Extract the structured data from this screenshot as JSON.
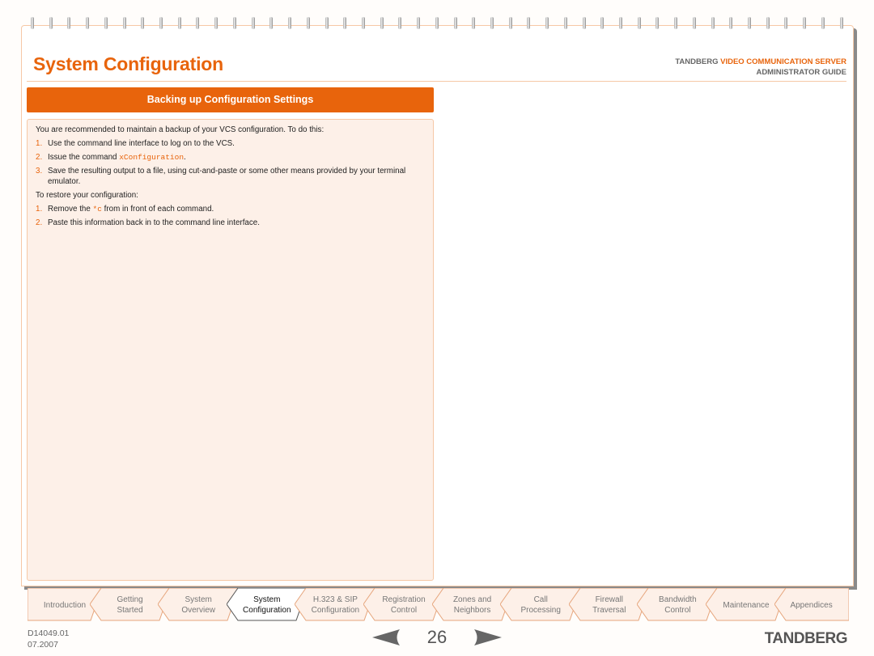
{
  "header": {
    "title": "System Configuration",
    "brand_prefix": "TANDBERG",
    "brand_product": "VIDEO COMMUNICATION SERVER",
    "guide": "ADMINISTRATOR GUIDE"
  },
  "section": {
    "title": "Backing up Configuration Settings",
    "intro": "You are recommended to maintain a backup of your VCS configuration. To do this:",
    "backup_steps": [
      {
        "num": "1.",
        "text": "Use the command line interface to log on to the VCS."
      },
      {
        "num": "2.",
        "text_before": "Issue the command ",
        "code": "xConfiguration",
        "text_after": "."
      },
      {
        "num": "3.",
        "text": "Save the resulting output to a file, using cut-and-paste or some other means provided by your terminal emulator."
      }
    ],
    "restore_intro": "To restore your configuration:",
    "restore_steps": [
      {
        "num": "1.",
        "text_before": "Remove the ",
        "code": "*c",
        "text_after": " from in front of each command."
      },
      {
        "num": "2.",
        "text": "Paste this information back in to the command line interface."
      }
    ]
  },
  "tabs": [
    {
      "line1": "Introduction",
      "line2": "",
      "active": false
    },
    {
      "line1": "Getting",
      "line2": "Started",
      "active": false
    },
    {
      "line1": "System",
      "line2": "Overview",
      "active": false
    },
    {
      "line1": "System",
      "line2": "Configuration",
      "active": true
    },
    {
      "line1": "H.323 & SIP",
      "line2": "Configuration",
      "active": false
    },
    {
      "line1": "Registration",
      "line2": "Control",
      "active": false
    },
    {
      "line1": "Zones and",
      "line2": "Neighbors",
      "active": false
    },
    {
      "line1": "Call",
      "line2": "Processing",
      "active": false
    },
    {
      "line1": "Firewall",
      "line2": "Traversal",
      "active": false
    },
    {
      "line1": "Bandwidth",
      "line2": "Control",
      "active": false
    },
    {
      "line1": "Maintenance",
      "line2": "",
      "active": false
    },
    {
      "line1": "Appendices",
      "line2": "",
      "active": false
    }
  ],
  "footer": {
    "doc_id": "D14049.01",
    "date": "07.2007",
    "page_number": "26",
    "prev_icon": "arrow-left-icon",
    "next_icon": "arrow-right-icon",
    "logo": "TANDBERG"
  },
  "colors": {
    "accent": "#e8640c",
    "panel_bg": "#fdf0e8",
    "border": "#f6c8a6"
  }
}
